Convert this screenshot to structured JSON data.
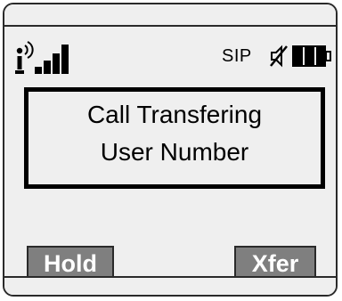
{
  "status_bar": {
    "protocol_label": "SIP",
    "icons": [
      "signal-strength-icon",
      "mute-icon",
      "battery-icon"
    ]
  },
  "message": {
    "line1": "Call Transfering",
    "line2": "User Number"
  },
  "softkeys": {
    "left_label": "Hold",
    "right_label": "Xfer"
  },
  "colors": {
    "screen_bg": "#efefef",
    "softkey_bg": "#7f7f7f",
    "softkey_text": "#ffffff",
    "border": "#000000"
  }
}
